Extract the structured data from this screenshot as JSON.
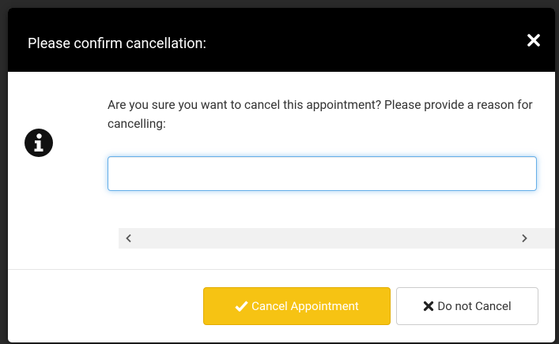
{
  "dialog": {
    "title": "Please confirm cancellation:",
    "message": "Are you sure you want to cancel this appointment? Please provide a reason for cancelling:",
    "reason_input": {
      "value": "",
      "placeholder": ""
    },
    "icons": {
      "close": "close-icon",
      "info": "info-circle-icon",
      "scroll_left": "chevron-left-icon",
      "scroll_right": "chevron-right-icon"
    },
    "buttons": {
      "confirm_label": "Cancel Appointment",
      "dismiss_label": "Do not Cancel"
    }
  },
  "colors": {
    "header_bg": "#000000",
    "confirm_bg": "#f6c313",
    "input_focus_border": "#66afe9"
  }
}
